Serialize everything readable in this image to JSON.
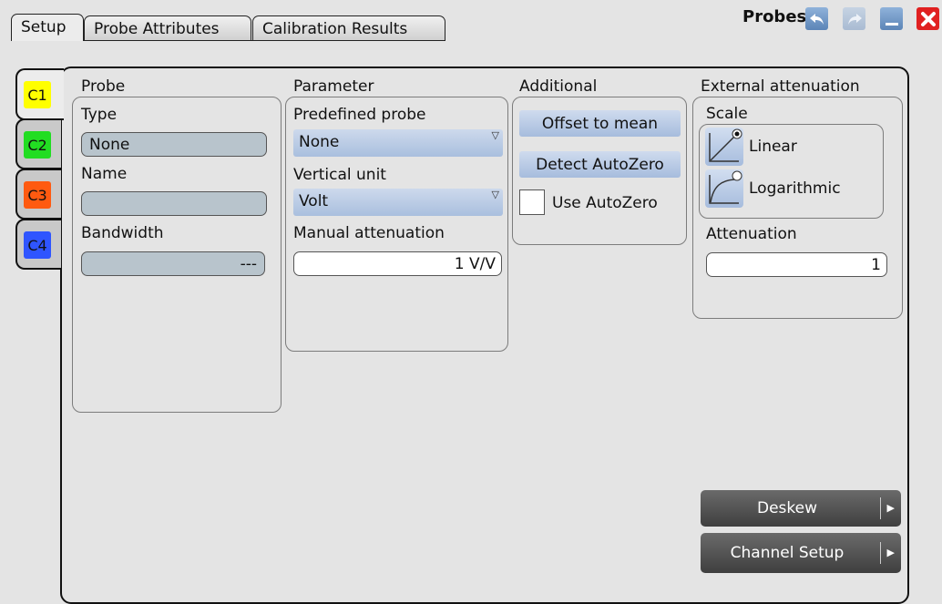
{
  "header": {
    "tabs": [
      "Setup",
      "Probe Attributes",
      "Calibration Results"
    ],
    "title": "Probes",
    "icons": [
      "undo-icon",
      "redo-icon",
      "minimize-icon",
      "close-icon"
    ]
  },
  "channels": [
    {
      "label": "C1",
      "color": "#ffff00"
    },
    {
      "label": "C2",
      "color": "#22dd22"
    },
    {
      "label": "C3",
      "color": "#ff5a10"
    },
    {
      "label": "C4",
      "color": "#2f55ff"
    }
  ],
  "probe": {
    "heading": "Probe",
    "type_label": "Type",
    "type_value": "None",
    "name_label": "Name",
    "name_value": "",
    "bandwidth_label": "Bandwidth",
    "bandwidth_value": "---"
  },
  "parameter": {
    "heading": "Parameter",
    "predefined_label": "Predefined probe",
    "predefined_value": "None",
    "vertical_unit_label": "Vertical unit",
    "vertical_unit_value": "Volt",
    "manual_att_label": "Manual attenuation",
    "manual_att_value": "1 V/V"
  },
  "additional": {
    "heading": "Additional",
    "offset_button": "Offset to mean",
    "detect_button": "Detect AutoZero",
    "use_autozero_label": "Use AutoZero",
    "use_autozero_checked": false
  },
  "external": {
    "heading": "External attenuation",
    "scale_label": "Scale",
    "linear_label": "Linear",
    "log_label": "Logarithmic",
    "selected_scale": "Linear",
    "attenuation_label": "Attenuation",
    "attenuation_value": "1"
  },
  "footer": {
    "deskew": "Deskew",
    "channel_setup": "Channel Setup"
  }
}
